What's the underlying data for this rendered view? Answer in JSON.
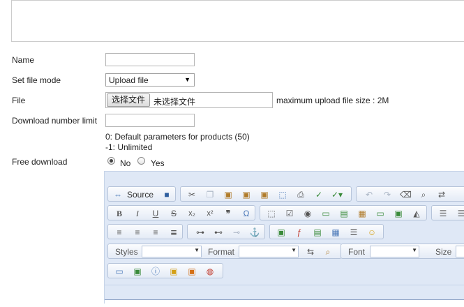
{
  "form": {
    "name_label": "Name",
    "file_mode_label": "Set file mode",
    "file_mode_value": "Upload file",
    "file_label": "File",
    "file_button": "选择文件",
    "file_status": "未选择文件",
    "max_upload": "maximum upload file size : 2M",
    "download_limit_label": "Download number limit",
    "hint_default": "0: Default parameters for products (50)",
    "hint_unlimited": "-1: Unlimited",
    "free_download_label": "Free download",
    "free_no": "No",
    "free_yes": "Yes",
    "free_selected": "No"
  },
  "editor": {
    "source_label": "Source",
    "styles_label": "Styles",
    "format_label": "Format",
    "font_label": "Font",
    "size_label": "Size"
  }
}
